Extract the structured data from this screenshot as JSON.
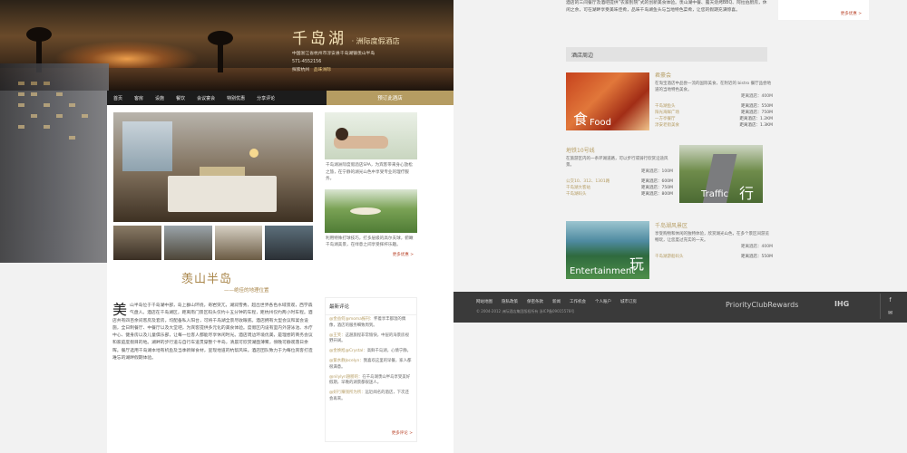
{
  "brand": {
    "name": "千岛湖",
    "subtitle": "· 洲际度假酒店"
  },
  "address": {
    "line1": "中国浙江省杭州市淳安县千岛湖镇羡山半岛",
    "line2": "571-4552156",
    "link1": "探索杭州",
    "link2": "品味洲际"
  },
  "nav": {
    "items": [
      "首页",
      "客房",
      "设施",
      "餐饮",
      "会议宴会",
      "特别优惠",
      "分享评论"
    ],
    "book": "预订此酒店"
  },
  "section": {
    "title": "羡山半岛",
    "sub": "——绝佳的地理位置"
  },
  "article": {
    "drop": "美",
    "text": "山半岛位于千岛湖中部，岛上群山环绕，奇岩突兀，湖润雪秀，超出世界各色水域景观，西学森气盘人。酒店在千岛湖区，距离南门景区码头仅约十五分钟的车程，距杭州仅约两小时车程。酒店共有四百余间客房及套房，均配备私人阳台，可将千岛湖全景尽收眼底。酒店拥有大型会议和宴会设施，全日制餐厅、中餐厅以及大堂吧，为宾客提供多元化的美食体验。度假区内设有室内外游泳池、水疗中心、健身房以及儿童俱乐部，让每一位客人都能尽享休闲时光。酒店周边环境优美，是理想的商务会议和家庭度假目的地。湖畔的步行道与自行车道贯穿整个半岛，清晨可欣赏湖面薄雾，傍晚可静观落日余晖。餐厅选用千岛湖本地有机鱼及当季新鲜食材，呈现地道的杭帮风味。酒店团队致力于为每位宾客打造难忘的湖畔假期体验。"
  },
  "sidebar": {
    "spa_text": "千岛湖洲际度假酒店SPA，为宾客带来身心放松之旅，在宁静的湖光山色中享受专业的理疗服务。",
    "golf_text": "利用特殊打球技巧，打多层级的高尔夫球，俯瞰千岛湖美景，在绿意之间享受挥杆乐趣。",
    "more": "更多优惠 >"
  },
  "news": {
    "title": "最新评论",
    "items": [
      {
        "who": "@金益何@moma报刊：",
        "text": "怀着享丰都温的偶像，酒店的服务细致周到。"
      },
      {
        "who": "@王笑：",
        "text": "这趟旅程非常愉快，中层的海景房视野开阔。"
      },
      {
        "who": "@金焕旭@Crystal：",
        "text": "高鲜千岛湖，心情宁静。"
      },
      {
        "who": "@紫水静Jocelyn：",
        "text": "我喜欢这里的早餐，家人都很满意。"
      },
      {
        "who": "@nilylyn翅膀的：",
        "text": "在千岛湖羡山半岛享受美好假期，早晚的湖景都很迷人。"
      },
      {
        "who": "@好行赚钱所为所：",
        "text": "远近闻名的酒店，下次还会再来。"
      }
    ],
    "more": "更多评论 >"
  },
  "right": {
    "top_text": "酒店的三间餐厅及酒吧提供“农家别院”式的创新美食体验。羡山湖中餐、露天烧烤BBQ、阿拉伯厨房，休闲之余，可在湖畔享受美味佳肴，品味千岛湖鱼头与当地特色菜肴，让您的假期充满惊喜。",
    "card_more": "更多优惠 >",
    "nearby_title": "酒店周边",
    "pois": [
      {
        "name": "君豪会",
        "desc": "在淘宝酒店中品尝一流的国际美食，在附近的 bistro 餐厅品尝地道的当地特色美食。",
        "dist_label": "距离酒店：400M",
        "rows": [
          {
            "l": "千岛湖鱼头",
            "r": "距离酒店：550M"
          },
          {
            "l": "阳光海鲜广场",
            "r": "距离酒店：750M"
          },
          {
            "l": "一方亭餐厅",
            "r": "距离酒店：1.2KM"
          },
          {
            "l": "淳安老街美食",
            "r": "距离酒店：1.3KM"
          }
        ],
        "cap": "Food",
        "big": "食"
      },
      {
        "name": "地铁10号线",
        "desc": "在旅游区内的一条环湖道路，可以步行或骑行欣赏沿途风景。",
        "dist_label": "距离酒店：100M",
        "rows": [
          {
            "l": "公交10、312、1301路",
            "r": "距离酒店：600M"
          },
          {
            "l": "千岛湖大客站",
            "r": "距离酒店：750M"
          },
          {
            "l": "千岛湖码头",
            "r": "距离酒店：800M"
          }
        ],
        "cap": "Traffic",
        "big": "行"
      },
      {
        "name": "千岛湖风景区",
        "desc": "享受购物和休闲的独特体验，欣赏湖光山色，在多个景区间游览畅玩，让您度过充实的一天。",
        "dist_label": "距离酒店：400M",
        "rows": [
          {
            "l": "千岛湖游船码头",
            "r": "距离酒店：550M"
          }
        ],
        "cap": "Entertainment",
        "big": "玩"
      }
    ]
  },
  "footer": {
    "links": [
      "网站地图",
      "隐私政策",
      "保密条款",
      "新闻",
      "工作机会",
      "个人账户",
      "城市订房"
    ],
    "copy": "© 2004-2012 洲际酒店集团版权所有   浙ICP备09015578号",
    "pcr": "PriorityClubRewards",
    "ihg": "IHG",
    "social": [
      "f",
      "✉",
      "✉"
    ]
  },
  "colors": {
    "gold": "#b59c62",
    "nav": "#1c1c1c",
    "footer": "#3a3a3a"
  }
}
